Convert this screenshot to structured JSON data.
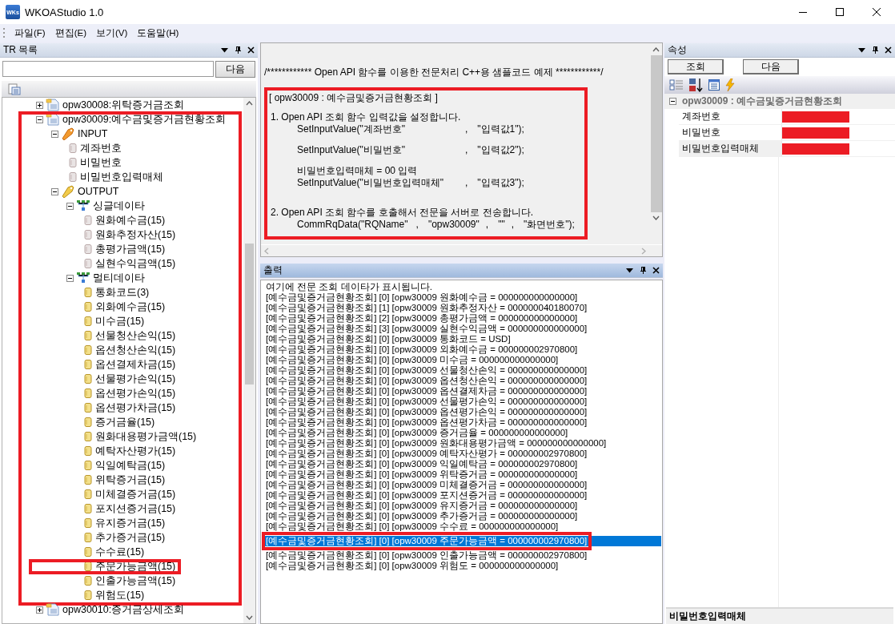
{
  "window": {
    "logo": "WKs",
    "title": "WKOAStudio 1.0"
  },
  "menu": [
    "파일(F)",
    "편집(E)",
    "보기(V)",
    "도움말(H)"
  ],
  "tr_panel": {
    "title": "TR 목록",
    "next_button": "다음",
    "tree": [
      {
        "label": "opw30008:위탁증거금조회",
        "kind": "tr",
        "expanded": false,
        "highlighted": false
      },
      {
        "label": "opw30009:예수금및증거금현황조회",
        "kind": "tr",
        "expanded": true,
        "highlighted": true,
        "children": [
          {
            "label": "INPUT",
            "kind": "input",
            "expanded": true,
            "highlighted": false,
            "children": [
              {
                "label": "계좌번호",
                "kind": "field",
                "highlighted": false
              },
              {
                "label": "비밀번호",
                "kind": "field",
                "highlighted": false
              },
              {
                "label": "비밀번호입력매체",
                "kind": "field",
                "highlighted": false
              }
            ]
          },
          {
            "label": "OUTPUT",
            "kind": "output",
            "expanded": true,
            "highlighted": false,
            "children": [
              {
                "label": "싱글데이타",
                "kind": "group",
                "expanded": true,
                "highlighted": false,
                "children": [
                  {
                    "label": "원화예수금(15)",
                    "kind": "field",
                    "highlighted": false
                  },
                  {
                    "label": "원화추정자산(15)",
                    "kind": "field",
                    "highlighted": false
                  },
                  {
                    "label": "총평가금액(15)",
                    "kind": "field",
                    "highlighted": false
                  },
                  {
                    "label": "실현수익금액(15)",
                    "kind": "field",
                    "highlighted": false
                  }
                ]
              },
              {
                "label": "멀티데이타",
                "kind": "group",
                "expanded": true,
                "highlighted": false,
                "children": [
                  {
                    "label": "통화코드(3)",
                    "kind": "multi_field",
                    "highlighted": false
                  },
                  {
                    "label": "외화예수금(15)",
                    "kind": "multi_field",
                    "highlighted": false
                  },
                  {
                    "label": "미수금(15)",
                    "kind": "multi_field",
                    "highlighted": false
                  },
                  {
                    "label": "선물청산손익(15)",
                    "kind": "multi_field",
                    "highlighted": false
                  },
                  {
                    "label": "옵션청산손익(15)",
                    "kind": "multi_field",
                    "highlighted": false
                  },
                  {
                    "label": "옵션결제차금(15)",
                    "kind": "multi_field",
                    "highlighted": false
                  },
                  {
                    "label": "선물평가손익(15)",
                    "kind": "multi_field",
                    "highlighted": false
                  },
                  {
                    "label": "옵션평가손익(15)",
                    "kind": "multi_field",
                    "highlighted": false
                  },
                  {
                    "label": "옵션평가차금(15)",
                    "kind": "multi_field",
                    "highlighted": false
                  },
                  {
                    "label": "증거금율(15)",
                    "kind": "multi_field",
                    "highlighted": false
                  },
                  {
                    "label": "원화대용평가금액(15)",
                    "kind": "multi_field",
                    "highlighted": false
                  },
                  {
                    "label": "예탁자산평가(15)",
                    "kind": "multi_field",
                    "highlighted": false
                  },
                  {
                    "label": "익일예탁금(15)",
                    "kind": "multi_field",
                    "highlighted": false
                  },
                  {
                    "label": "위탁증거금(15)",
                    "kind": "multi_field",
                    "highlighted": false
                  },
                  {
                    "label": "미체결증거금(15)",
                    "kind": "multi_field",
                    "highlighted": false
                  },
                  {
                    "label": "포지션증거금(15)",
                    "kind": "multi_field",
                    "highlighted": false
                  },
                  {
                    "label": "유지증거금(15)",
                    "kind": "multi_field",
                    "highlighted": false
                  },
                  {
                    "label": "추가증거금(15)",
                    "kind": "multi_field",
                    "highlighted": false
                  },
                  {
                    "label": "수수료(15)",
                    "kind": "multi_field",
                    "highlighted": false
                  },
                  {
                    "label": "주문가능금액(15)",
                    "kind": "multi_field",
                    "highlighted": true
                  },
                  {
                    "label": "인출가능금액(15)",
                    "kind": "multi_field",
                    "highlighted": false
                  },
                  {
                    "label": "위험도(15)",
                    "kind": "multi_field",
                    "highlighted": false
                  }
                ]
              }
            ]
          }
        ]
      },
      {
        "label": "opw30010:증거금상세조회",
        "kind": "tr",
        "expanded": false,
        "highlighted": false
      }
    ]
  },
  "code_panel": {
    "comment": "/************ Open API 함수를 이용한 전문처리 C++용 샘플코드 예제 ************/",
    "highlighted": true,
    "lines": [
      {
        "kind": "title",
        "text": "[ opw30009 : 예수금및증거금현황조회 ]"
      },
      {
        "kind": "step",
        "text": "1. Open API 조회 함수 입력값을 설정합니다."
      },
      {
        "kind": "call",
        "parts": [
          "SetInputValue(\"계좌번호\"",
          ",",
          "\"입력값1\");"
        ]
      },
      {
        "kind": "call",
        "parts": [
          "SetInputValue(\"비밀번호\"",
          ",",
          "\"입력값2\");"
        ]
      },
      {
        "kind": "note",
        "text": "비밀번호입력매체 = 00 입력"
      },
      {
        "kind": "call",
        "parts": [
          "SetInputValue(\"비밀번호입력매체\"",
          ",",
          "\"입력값3\");"
        ]
      },
      {
        "kind": "step",
        "text": "2. Open API 조회 함수를 호출해서 전문을 서버로 전송합니다."
      },
      {
        "kind": "call",
        "parts": [
          "CommRqData(\"RQName\"",
          ",",
          "\"opw30009\"",
          ",",
          "\"\"",
          ",",
          "\"화면번호\");"
        ]
      }
    ]
  },
  "output_panel": {
    "title": "출력",
    "lines": [
      {
        "text": "여기에 전문 조회 데이타가 표시됩니다.",
        "selected": false,
        "highlighted": false
      },
      {
        "text": "[예수금및증거금현황조회] [0] [opw30009 원화예수금 = 000000000000000]",
        "selected": false,
        "highlighted": false
      },
      {
        "text": "[예수금및증거금현황조회] [1] [opw30009 원화추정자산 = 000000040180070]",
        "selected": false,
        "highlighted": false
      },
      {
        "text": "[예수금및증거금현황조회] [2] [opw30009 총평가금액 = 000000000000000]",
        "selected": false,
        "highlighted": false
      },
      {
        "text": "[예수금및증거금현황조회] [3] [opw30009 실현수익금액 = 000000000000000]",
        "selected": false,
        "highlighted": false
      },
      {
        "text": "[예수금및증거금현황조회] [0] [opw30009 통화코드 = USD]",
        "selected": false,
        "highlighted": false
      },
      {
        "text": "[예수금및증거금현황조회] [0] [opw30009 외화예수금 = 000000002970800]",
        "selected": false,
        "highlighted": false
      },
      {
        "text": "[예수금및증거금현황조회] [0] [opw30009 미수금 = 000000000000000]",
        "selected": false,
        "highlighted": false
      },
      {
        "text": "[예수금및증거금현황조회] [0] [opw30009 선물청산손익 = 000000000000000]",
        "selected": false,
        "highlighted": false
      },
      {
        "text": "[예수금및증거금현황조회] [0] [opw30009 옵션청산손익 = 000000000000000]",
        "selected": false,
        "highlighted": false
      },
      {
        "text": "[예수금및증거금현황조회] [0] [opw30009 옵션결제차금 = 000000000000000]",
        "selected": false,
        "highlighted": false
      },
      {
        "text": "[예수금및증거금현황조회] [0] [opw30009 선물평가손익 = 000000000000000]",
        "selected": false,
        "highlighted": false
      },
      {
        "text": "[예수금및증거금현황조회] [0] [opw30009 옵션평가손익 = 000000000000000]",
        "selected": false,
        "highlighted": false
      },
      {
        "text": "[예수금및증거금현황조회] [0] [opw30009 옵션평가차금 = 000000000000000]",
        "selected": false,
        "highlighted": false
      },
      {
        "text": "[예수금및증거금현황조회] [0] [opw30009 증거금율 = 000000000000000]",
        "selected": false,
        "highlighted": false
      },
      {
        "text": "[예수금및증거금현황조회] [0] [opw30009 원화대용평가금액 = 000000000000000]",
        "selected": false,
        "highlighted": false
      },
      {
        "text": "[예수금및증거금현황조회] [0] [opw30009 예탁자산평가 = 000000002970800]",
        "selected": false,
        "highlighted": false
      },
      {
        "text": "[예수금및증거금현황조회] [0] [opw30009 익일예탁금 = 000000002970800]",
        "selected": false,
        "highlighted": false
      },
      {
        "text": "[예수금및증거금현황조회] [0] [opw30009 위탁증거금 = 000000000000000]",
        "selected": false,
        "highlighted": false
      },
      {
        "text": "[예수금및증거금현황조회] [0] [opw30009 미체결증거금 = 000000000000000]",
        "selected": false,
        "highlighted": false
      },
      {
        "text": "[예수금및증거금현황조회] [0] [opw30009 포지션증거금 = 000000000000000]",
        "selected": false,
        "highlighted": false
      },
      {
        "text": "[예수금및증거금현황조회] [0] [opw30009 유지증거금 = 000000000000000]",
        "selected": false,
        "highlighted": false
      },
      {
        "text": "[예수금및증거금현황조회] [0] [opw30009 추가증거금 = 000000000000000]",
        "selected": false,
        "highlighted": false
      },
      {
        "text": "[예수금및증거금현황조회] [0] [opw30009 수수료 = 000000000000000]",
        "selected": false,
        "highlighted": false
      },
      {
        "text": "[예수금및증거금현황조회] [0] [opw30009 주문가능금액 = 000000002970800]",
        "selected": true,
        "highlighted": true
      },
      {
        "text": "[예수금및증거금현황조회] [0] [opw30009 인출가능금액 = 000000002970800]",
        "selected": false,
        "highlighted": false
      },
      {
        "text": "[예수금및증거금현황조회] [0] [opw30009 위험도 = 000000000000000]",
        "selected": false,
        "highlighted": false
      }
    ]
  },
  "properties_panel": {
    "title": "속성",
    "buttons": [
      "조회",
      "다음"
    ],
    "category": {
      "label": "opw30009 : 예수금및증거금현황조회",
      "expanded": true
    },
    "rows": [
      {
        "name": "계좌번호",
        "redacted": true,
        "selected": false
      },
      {
        "name": "비밀번호",
        "redacted": true,
        "selected": false
      },
      {
        "name": "비밀번호입력매체",
        "redacted": true,
        "selected": true
      }
    ],
    "description": "비밀번호입력매체"
  }
}
